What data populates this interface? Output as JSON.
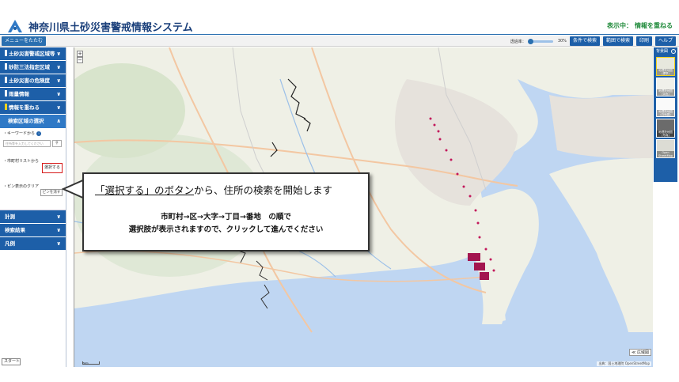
{
  "header": {
    "title": "神奈川県土砂災害警戒情報システム",
    "status_label": "表示中：",
    "status_value": "情報を重ねる"
  },
  "toolbar": {
    "menu_toggle": "メニューをたたむ",
    "opacity_label": "透過率：",
    "opacity_value": "30%",
    "opacity_fraction": 0.0,
    "buttons": [
      "条件で検索",
      "範囲で検索",
      "印刷",
      "ヘルプ"
    ]
  },
  "sidebar": {
    "items": [
      {
        "label": "土砂災害警戒区域等"
      },
      {
        "label": "砂防三法指定区域"
      },
      {
        "label": "土砂災害の危険度"
      },
      {
        "label": "雨量情報"
      },
      {
        "label": "情報を重ねる"
      }
    ],
    "sub_section": "検索区域の選択",
    "keyword_label": "キーワードから",
    "keyword_placeholder": "住所等を入力してください",
    "list_label": "市町村リストから",
    "select_button": "選択する",
    "pin_label": "ピン表示のクリア",
    "pin_button": "ピンを消す",
    "items_bottom": [
      {
        "label": "計測"
      },
      {
        "label": "検索結果"
      },
      {
        "label": "凡例"
      }
    ],
    "start_tab": "スタート"
  },
  "map": {
    "scale_label": "5km",
    "attribution": "出典：国土地理院 OpenStreetMap",
    "wide_button": "≪ 広域図"
  },
  "callout": {
    "line1_emph": "「選択する」のボタン",
    "line1_rest": "から、住所の検索を開始します",
    "line2": "市町村→区→大字→丁目→番地　の順で",
    "line3": "選択肢が表示されますので、クリックして進んでください"
  },
  "basemap_panel": {
    "title": "背景図",
    "tiles": [
      "地理院地図(標準)",
      "地理院地図(淡色)",
      "地理院地図(白地図)",
      "地理院地図(写真)",
      "Open StreetMap"
    ]
  }
}
